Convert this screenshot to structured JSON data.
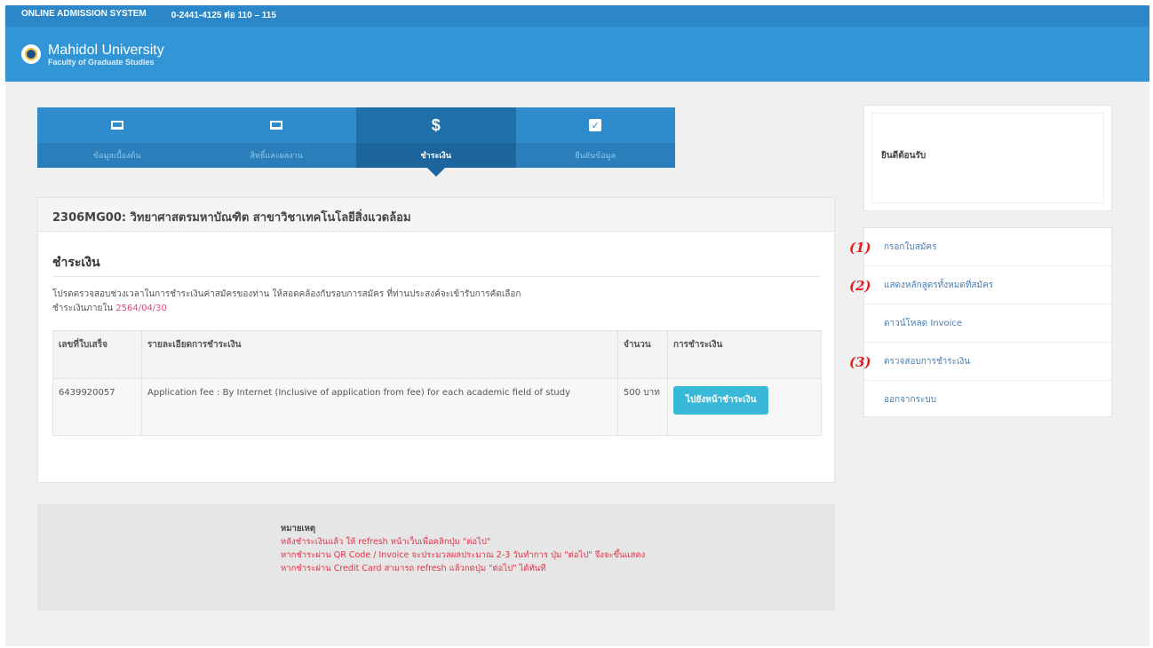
{
  "topbar": {
    "system_name": "ONLINE ADMISSION SYSTEM",
    "phone": "0-2441-4125 ต่อ 110 – 115"
  },
  "brand": {
    "name": "Mahidol University",
    "sub": "Faculty of Graduate Studies"
  },
  "steps": [
    {
      "label": "ข้อมูลเบื้องต้น",
      "icon": "laptop-icon"
    },
    {
      "label": "สิทธิ์และผลงาน",
      "icon": "laptop-icon"
    },
    {
      "label": "ชำระเงิน",
      "icon": "dollar-icon",
      "active": true
    },
    {
      "label": "ยืนยันข้อมูล",
      "icon": "checkbox-icon"
    }
  ],
  "program_title": "2306MG00: วิทยาศาสตรมหาบัณฑิต สาขาวิชาเทคโนโลยีสิ่งแวดล้อม",
  "payment": {
    "title": "ชำระเงิน",
    "desc_line1": "โปรดตรวจสอบช่วงเวลาในการชำระเงินค่าสมัครของท่าน ให้สอดคล้องกับรอบการสมัคร ที่ท่านประสงค์จะเข้ารับการคัดเลือก",
    "deadline_label": "ชำระเงินภายใน",
    "deadline": "2564/04/30",
    "table": {
      "headers": [
        "เลขที่ใบเสร็จ",
        "รายละเอียดการชำระเงิน",
        "จำนวน",
        "การชำระเงิน"
      ],
      "row": {
        "receipt": "6439920057",
        "detail": "Application fee : By Internet (Inclusive of application from fee) for each academic field of study",
        "amount": "500 บาท",
        "button": "ไปยังหน้าชำระเงิน"
      }
    }
  },
  "note": {
    "title": "หมายเหตุ",
    "lines": [
      "หลังชำระเงินแล้ว ให้ refresh หน้าเว็บเพื่อคลิกปุ่ม \"ต่อไป\"",
      "หากชำระผ่าน QR Code / Invoice จะประมวลผลประมาณ 2-3 วันทำการ ปุ่ม \"ต่อไป\" จึงจะขึ้นแสดง",
      "หากชำระผ่าน Credit Card สามารถ refresh แล้วกดปุ่ม \"ต่อไป\" ได้ทันที"
    ]
  },
  "welcome": {
    "text": "ยินดีต้อนรับ"
  },
  "menu": [
    "กรอกใบสมัคร",
    "แสดงหลักสูตรทั้งหมดที่สมัคร",
    "ดาวน์โหลด Invoice",
    "ตรวจสอบการชำระเงิน",
    "ออกจากระบบ"
  ],
  "annotations": [
    "(1)",
    "(2)",
    "(3)"
  ]
}
